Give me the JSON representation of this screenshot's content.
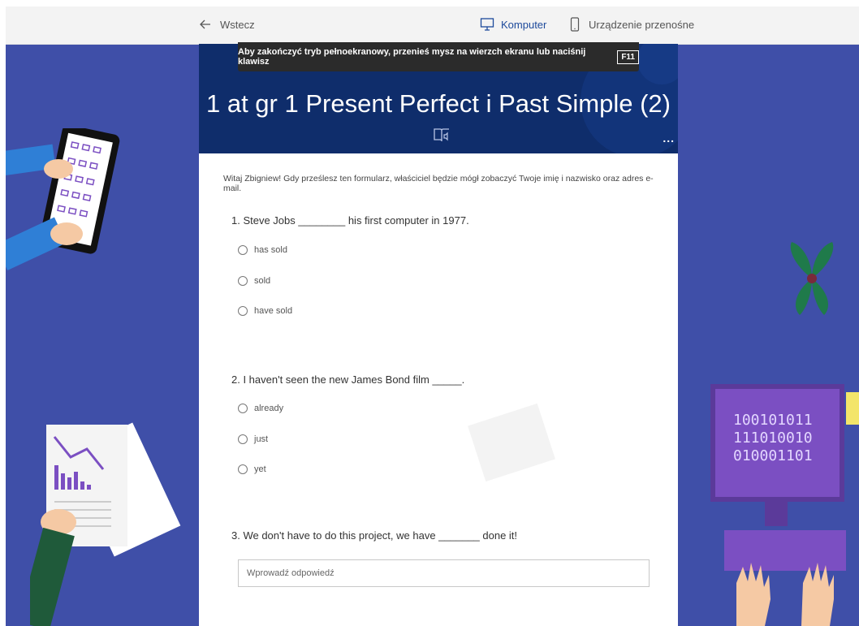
{
  "toolbar": {
    "back_label": "Wstecz",
    "desktop_label": "Komputer",
    "mobile_label": "Urządzenie przenośne"
  },
  "fullscreen_banner": {
    "text": "Aby zakończyć tryb pełnoekranowy, przenieś mysz na wierzch ekranu lub naciśnij klawisz",
    "key": "F11"
  },
  "form": {
    "title": "1 at gr 1 Present Perfect i Past Simple (2)",
    "more": "...",
    "intro": "Witaj Zbigniew! Gdy prześlesz ten formularz, właściciel będzie mógł zobaczyć Twoje imię i nazwisko oraz adres e-mail.",
    "questions": [
      {
        "text": "1. Steve Jobs ________ his first computer in 1977.",
        "options": [
          "has sold",
          "sold",
          "have sold"
        ]
      },
      {
        "text": "2. I haven't seen the new James Bond film _____.",
        "options": [
          "already",
          "just",
          "yet"
        ]
      },
      {
        "text": "3. We don't have to do this project, we have _______ done it!",
        "placeholder": "Wprowadź odpowiedź"
      }
    ]
  },
  "background": {
    "binary_lines": [
      "100101011",
      "111010010",
      "010001101"
    ]
  },
  "colors": {
    "page_bg": "#3f4fa8",
    "header_bg": "#0f2d6b",
    "accent": "#1d4a9b"
  }
}
